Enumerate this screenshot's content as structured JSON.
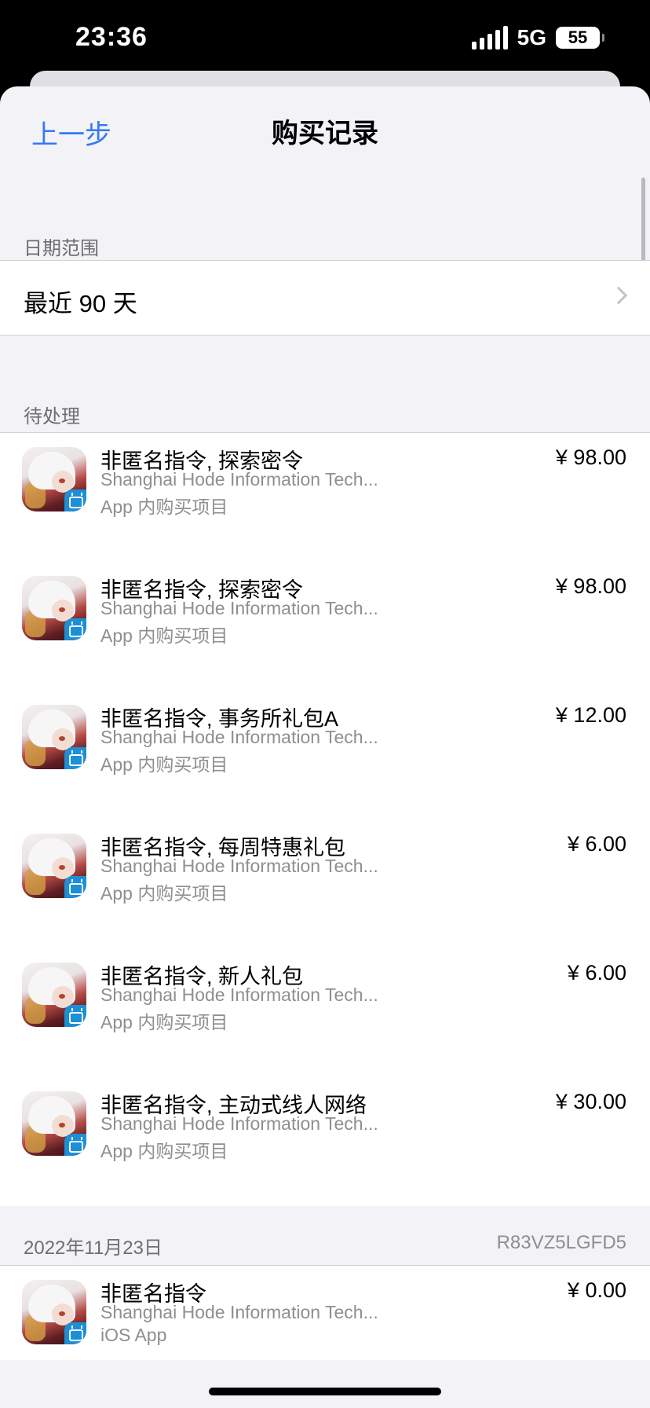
{
  "status": {
    "time": "23:36",
    "network": "5G",
    "battery": "55"
  },
  "nav": {
    "back_label": "上一步",
    "title": "购买记录"
  },
  "date_section": {
    "header": "日期范围",
    "value": "最近 90 天"
  },
  "pending": {
    "header": "待处理",
    "items": [
      {
        "title": "非匿名指令, 探索密令",
        "developer": "Shanghai Hode Information Tech...",
        "type": "App 内购买项目",
        "price": "¥ 98.00"
      },
      {
        "title": "非匿名指令, 探索密令",
        "developer": "Shanghai Hode Information Tech...",
        "type": "App 内购买项目",
        "price": "¥ 98.00"
      },
      {
        "title": "非匿名指令, 事务所礼包A",
        "developer": "Shanghai Hode Information Tech...",
        "type": "App 内购买项目",
        "price": "¥ 12.00"
      },
      {
        "title": "非匿名指令, 每周特惠礼包",
        "developer": "Shanghai Hode Information Tech...",
        "type": "App 内购买项目",
        "price": "¥ 6.00"
      },
      {
        "title": "非匿名指令, 新人礼包",
        "developer": "Shanghai Hode Information Tech...",
        "type": "App 内购买项目",
        "price": "¥ 6.00"
      },
      {
        "title": "非匿名指令, 主动式线人网络",
        "developer": "Shanghai Hode Information Tech...",
        "type": "App 内购买项目",
        "price": "¥ 30.00"
      }
    ]
  },
  "order": {
    "date": "2022年11月23日",
    "order_id": "R83VZ5LGFD5",
    "items": [
      {
        "title": "非匿名指令",
        "developer": "Shanghai Hode Information Tech...",
        "type": "iOS App",
        "price": "¥ 0.00"
      }
    ]
  }
}
